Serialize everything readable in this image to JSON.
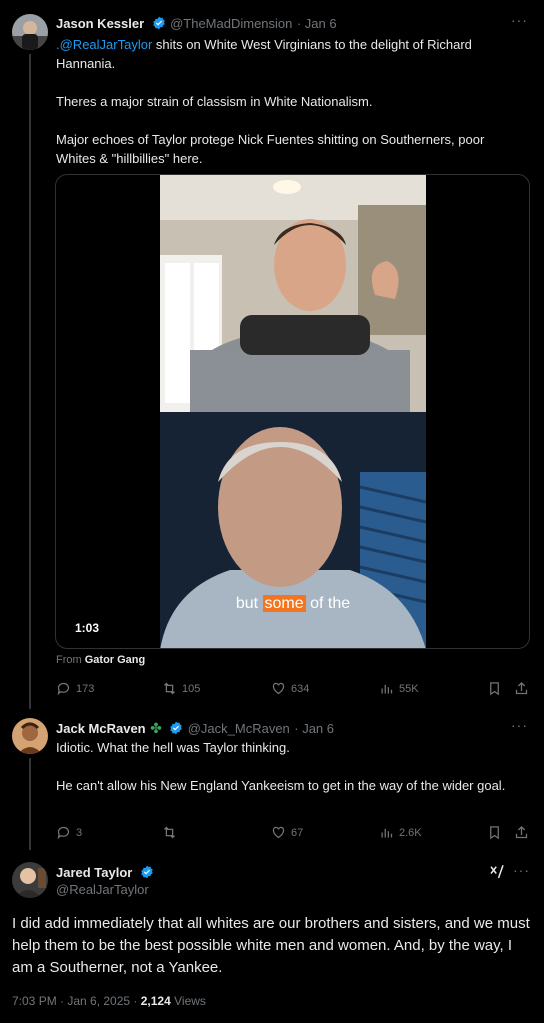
{
  "tweet1": {
    "name": "Jason Kessler",
    "handle": "@TheMadDimension",
    "date": "· Jan 6",
    "mention": ".@RealJarTaylor",
    "line1_rest": " shits on White West Virginians to the delight of Richard Hannania.",
    "para2": "Theres a major strain of classism in White Nationalism.",
    "para3": "Major echoes of Taylor protege Nick Fuentes shitting on Southerners, poor Whites & \"hillbillies\" here.",
    "video": {
      "duration": "1:03",
      "caption_before": "but ",
      "caption_highlight": "some",
      "caption_after": " of the"
    },
    "from_label": "From",
    "from_source": "Gator Gang",
    "stats": {
      "replies": "173",
      "reposts": "105",
      "likes": "634",
      "views": "55K"
    }
  },
  "tweet2": {
    "name": "Jack McRaven",
    "emoji": "✤",
    "handle": "@Jack_McRaven",
    "date": "· Jan 6",
    "para1": "Idiotic. What the hell was Taylor thinking.",
    "para2": "He can't allow his New England Yankeeism to get in the way of the wider goal.",
    "stats": {
      "replies": "3",
      "reposts": "",
      "likes": "67",
      "views": "2.6K"
    }
  },
  "tweet3": {
    "name": "Jared Taylor",
    "handle": "@RealJarTaylor",
    "text": "I did add immediately that all whites are our brothers and sisters, and we must help them to be the best possible white men and women. And, by the way, I am a Southerner, not a Yankee.",
    "time": "7:03 PM · Jan 6, 2025 · ",
    "views_count": "2,124",
    "views_label": " Views"
  },
  "colors": {
    "accent": "#1d9bf0",
    "muted": "#71767b",
    "caption_highlight": "#f4751f",
    "shamrock": "#3ba55c"
  }
}
